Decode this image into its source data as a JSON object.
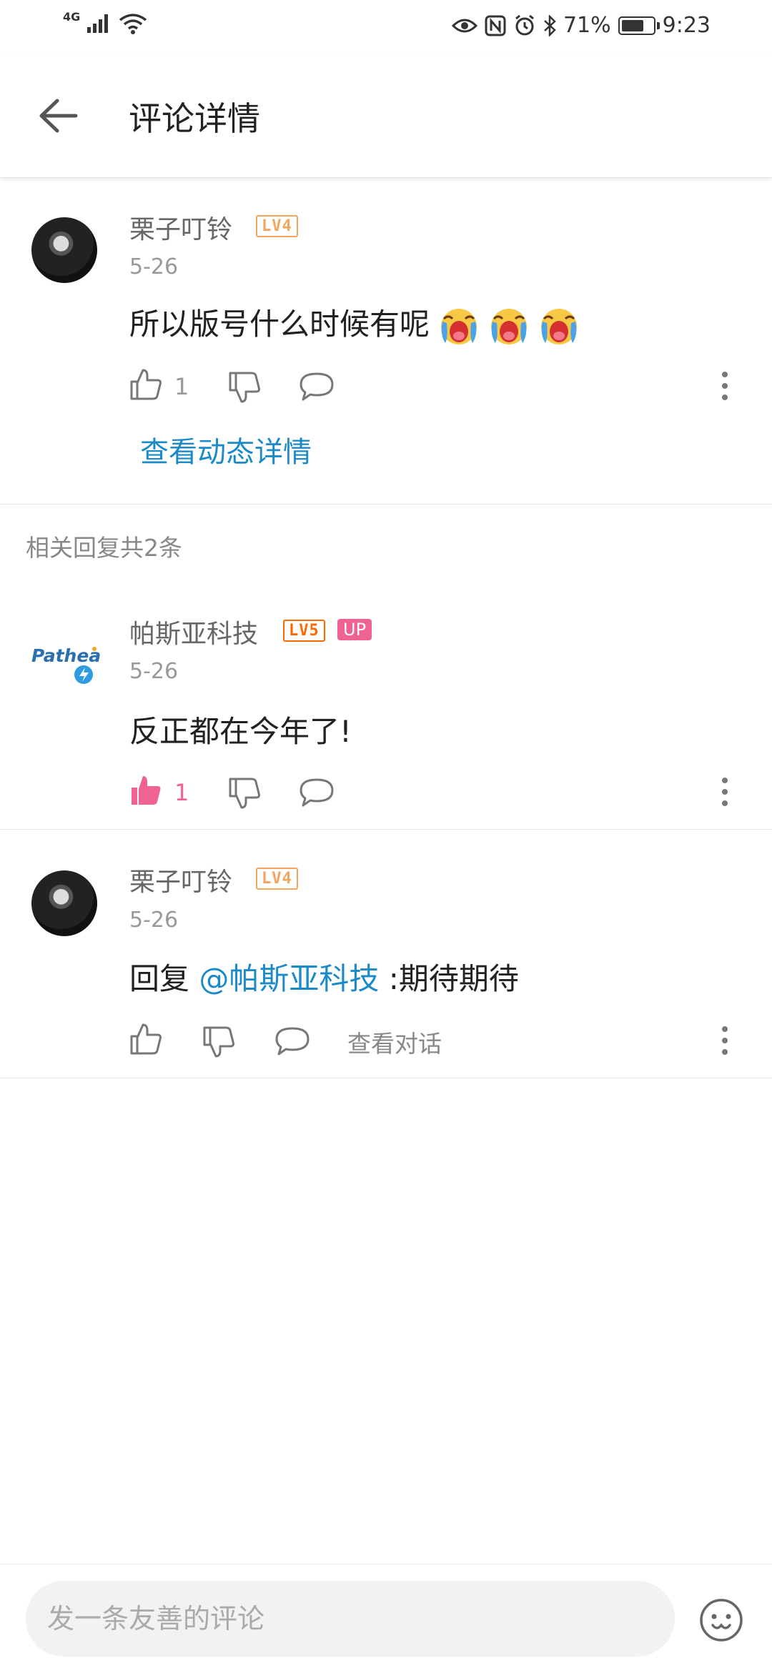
{
  "status_bar": {
    "network": "4G",
    "battery_text": "71%",
    "battery_level": 0.71,
    "time": "9:23",
    "icons": [
      "signal-icon",
      "wifi-icon",
      "eye-icon",
      "nfc-icon",
      "alarm-icon",
      "bluetooth-icon",
      "battery-icon"
    ]
  },
  "header": {
    "title": "评论详情",
    "back_icon": "arrow-left-icon"
  },
  "main_comment": {
    "username": "栗子叮铃",
    "level": "LV4",
    "date": "5-26",
    "text": "所以版号什么时候有呢",
    "emoji_count": 3,
    "emoji_name": "crying-emoji",
    "likes": "1",
    "view_post_label": "查看动态详情"
  },
  "replies_section": {
    "label": "相关回复共2条"
  },
  "replies": [
    {
      "username": "帕斯亚科技",
      "level": "LV5",
      "badge": "UP",
      "avatar_logo_text": "Pathea",
      "date": "5-26",
      "text": "反正都在今年了!",
      "likes": "1",
      "liked": true
    },
    {
      "username": "栗子叮铃",
      "level": "LV4",
      "date": "5-26",
      "reply_prefix": "回复",
      "mention": "@帕斯亚科技",
      "text": ":期待期待",
      "view_conversation_label": "查看对话"
    }
  ],
  "bottom_bar": {
    "placeholder": "发一条友善的评论",
    "emoji_icon": "smiley-icon"
  },
  "colors": {
    "accent_blue": "#1b8ac9",
    "like_pink": "#f06292",
    "lv4": "#f4a45c",
    "lv5": "#ff6a00"
  }
}
